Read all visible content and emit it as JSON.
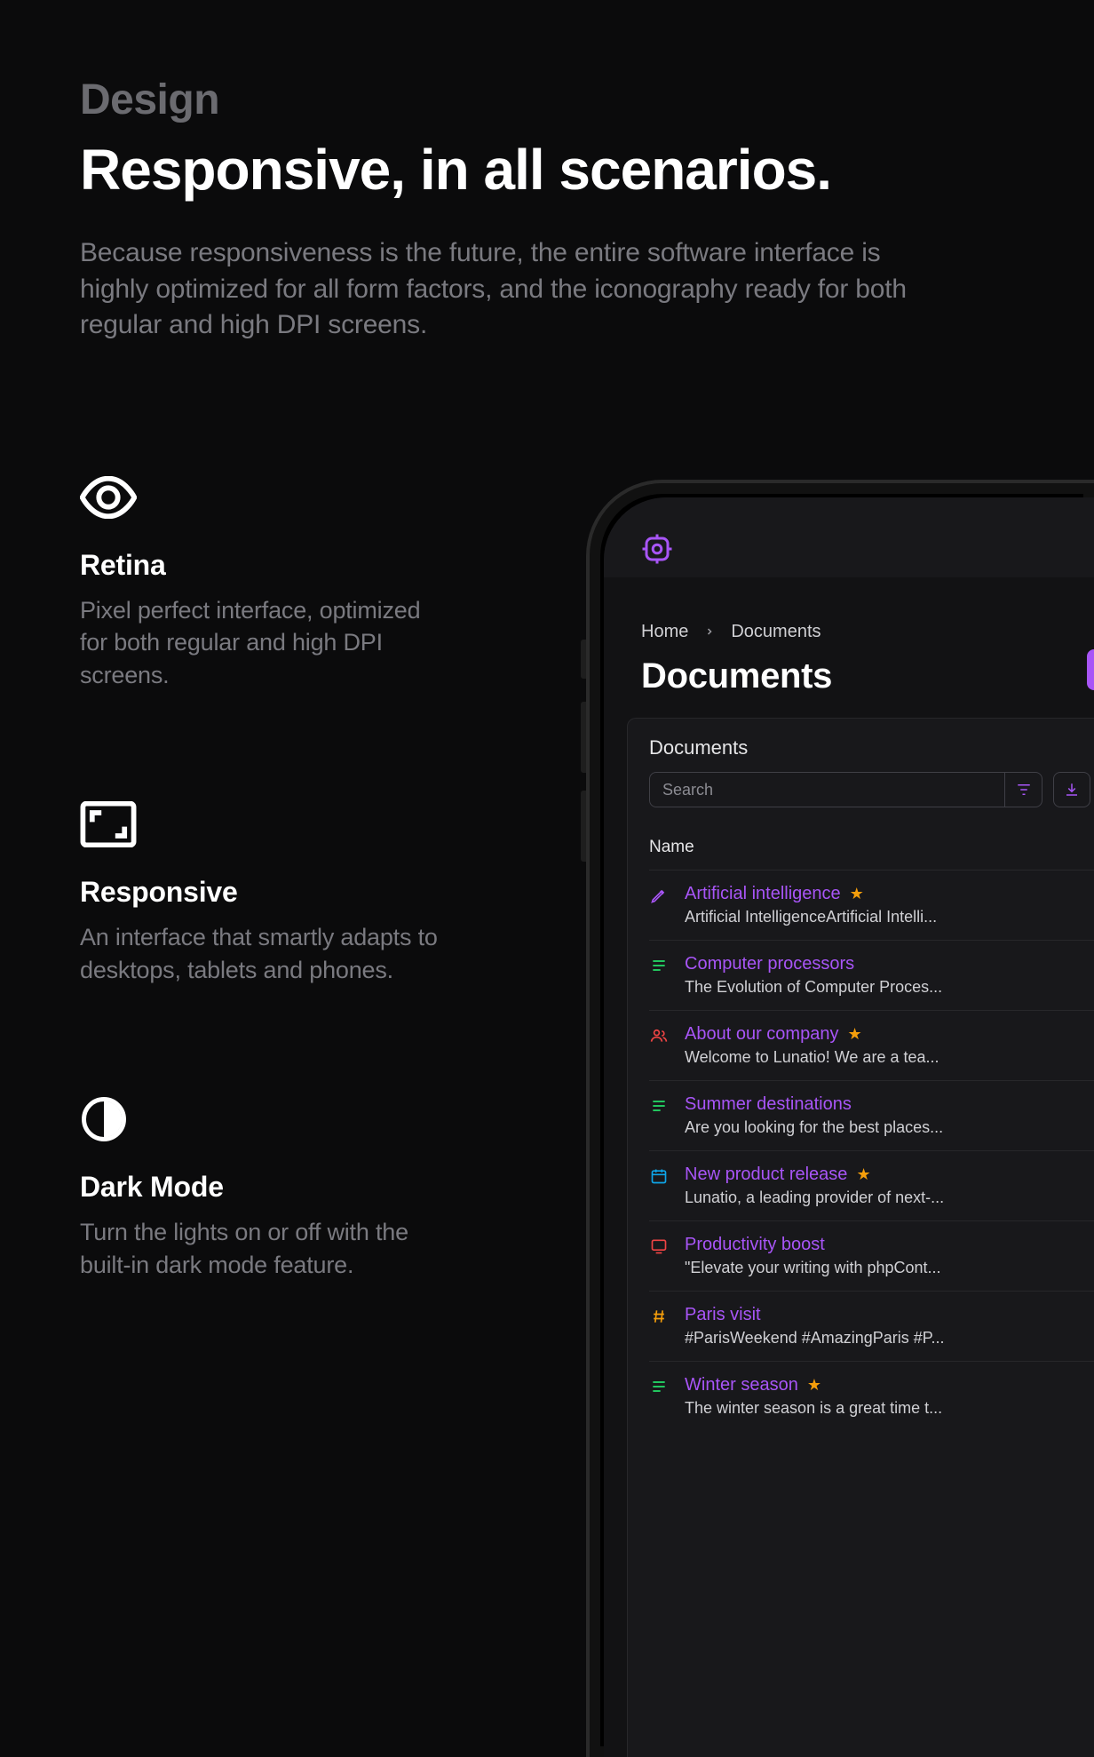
{
  "hero": {
    "eyebrow": "Design",
    "headline": "Responsive, in all scenarios.",
    "subcopy": "Because responsiveness is the future, the entire software interface is highly optimized for all form factors, and the iconography ready for both regular and high DPI screens."
  },
  "features": [
    {
      "title": "Retina",
      "desc": "Pixel perfect interface, optimized for both regular and high DPI screens."
    },
    {
      "title": "Responsive",
      "desc": "An interface that smartly adapts to desktops, tablets and phones."
    },
    {
      "title": "Dark Mode",
      "desc": "Turn the lights on or off with the built-in dark mode feature."
    }
  ],
  "phone": {
    "breadcrumbs": [
      "Home",
      "Documents"
    ],
    "page_title": "Documents",
    "panel_title": "Documents",
    "search_placeholder": "Search",
    "column_header": "Name",
    "rows": [
      {
        "icon": "pencil",
        "color": "ic-purple",
        "title": "Artificial intelligence",
        "starred": true,
        "sub": "Artificial IntelligenceArtificial Intelli..."
      },
      {
        "icon": "lines",
        "color": "ic-green",
        "title": "Computer processors",
        "starred": false,
        "sub": "The Evolution of Computer Proces..."
      },
      {
        "icon": "users",
        "color": "ic-red",
        "title": "About our company",
        "starred": true,
        "sub": "Welcome to Lunatio! We are a tea..."
      },
      {
        "icon": "lines",
        "color": "ic-green",
        "title": "Summer destinations",
        "starred": false,
        "sub": "Are you looking for the best places..."
      },
      {
        "icon": "cal",
        "color": "ic-sky",
        "title": "New product release",
        "starred": true,
        "sub": "Lunatio, a leading provider of next-..."
      },
      {
        "icon": "screen",
        "color": "ic-red",
        "title": "Productivity boost",
        "starred": false,
        "sub": "\"Elevate your writing with phpCont..."
      },
      {
        "icon": "hash",
        "color": "ic-amber",
        "title": "Paris visit",
        "starred": false,
        "sub": "#ParisWeekend #AmazingParis #P..."
      },
      {
        "icon": "lines",
        "color": "ic-green",
        "title": "Winter season",
        "starred": true,
        "sub": "The winter season is a great time t..."
      }
    ]
  }
}
